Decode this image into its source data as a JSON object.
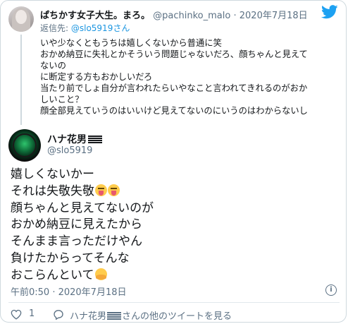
{
  "parent_tweet": {
    "name": "ぱちかす女子大生。まろ。",
    "handle": "@pachinko_malo",
    "dot": "·",
    "date": "2020年7月18日",
    "reply_prefix": "返信先: ",
    "reply_mention": "@slo5919さん",
    "lines": [
      "いや少なくともうちは嬉しくないから普通に笑",
      "おかめ納豆に失礼とかそういう問題じゃないだろ、顔ちゃんと見えて",
      "ないの",
      "に断定する方もおかしいだろ",
      "当たり前でしょ自分が言われたらいやなこと言われてきれるのがおか",
      "しいこと？",
      "顔全部見えていうのはいいけど見えてないのにいうのはわからないし"
    ]
  },
  "main_tweet": {
    "name": "ハナ花男",
    "handle": "@slo5919",
    "lines": [
      "嬉しくないかー",
      "それは失敬失敬",
      "顔ちゃんと見えてないのが",
      "おかめ納豆に見えたから",
      "そんまま言っただけやん",
      "負けたからってそんな",
      "おこらんといて"
    ],
    "timestamp": "午前0:50 · 2020年7月18日"
  },
  "footer": {
    "like_count": "1",
    "more_prefix": "ハナ花男",
    "more_suffix": "さんの他のツイートを見る"
  },
  "colors": {
    "twitter_blue": "#1da1f2",
    "mention_blue": "#1b95e0",
    "gray_text": "#5b7083",
    "border": "#cfd9de"
  },
  "icons": [
    "twitter-bird-icon",
    "info-icon",
    "heart-icon",
    "comment-icon",
    "squinting-tongue-emoji",
    "hugging-face-emoji"
  ]
}
